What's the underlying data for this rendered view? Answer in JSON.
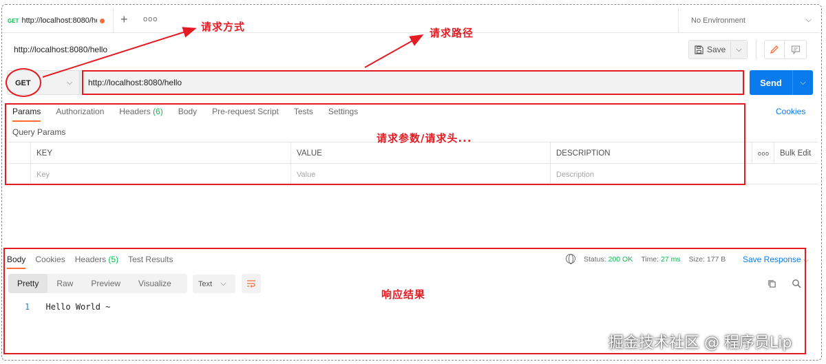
{
  "tab": {
    "method": "GET",
    "title": "http://localhost:8080/hello"
  },
  "environment": "No Environment",
  "request": {
    "title": "http://localhost:8080/hello",
    "save_label": "Save",
    "method": "GET",
    "url": "http://localhost:8080/hello",
    "send_label": "Send"
  },
  "request_tabs": {
    "params": "Params",
    "authorization": "Authorization",
    "headers": "Headers",
    "headers_count": "(6)",
    "body": "Body",
    "prerequest": "Pre-request Script",
    "tests": "Tests",
    "settings": "Settings",
    "cookies": "Cookies"
  },
  "query_params": {
    "label": "Query Params",
    "headers": [
      "KEY",
      "VALUE",
      "DESCRIPTION"
    ],
    "placeholders": [
      "Key",
      "Value",
      "Description"
    ],
    "bulk_edit": "Bulk Edit",
    "more": "ooo"
  },
  "response": {
    "tabs": {
      "body": "Body",
      "cookies": "Cookies",
      "headers": "Headers",
      "headers_count": "(5)",
      "tests": "Test Results"
    },
    "status_label": "Status:",
    "status_value": "200 OK",
    "time_label": "Time:",
    "time_value": "27 ms",
    "size_label": "Size:",
    "size_value": "177 B",
    "save_response": "Save Response",
    "views": [
      "Pretty",
      "Raw",
      "Preview",
      "Visualize"
    ],
    "format": "Text",
    "line_number": "1",
    "body_text": "Hello World ~"
  },
  "annotations": {
    "method": "请求方式",
    "path": "请求路径",
    "params": "请求参数/请求头...",
    "result": "响应结果"
  },
  "watermark": "掘金技术社区 @ 程序员Lip",
  "colors": {
    "accent": "#ff6c37",
    "primary": "#097bed",
    "success": "#0cbb52",
    "annotation": "#e31b23"
  },
  "icons": [
    "plus-icon",
    "more-icon",
    "chevron-down-icon",
    "save-icon",
    "edit-icon",
    "comment-icon",
    "globe-icon",
    "wrap-icon",
    "copy-icon",
    "search-icon"
  ]
}
